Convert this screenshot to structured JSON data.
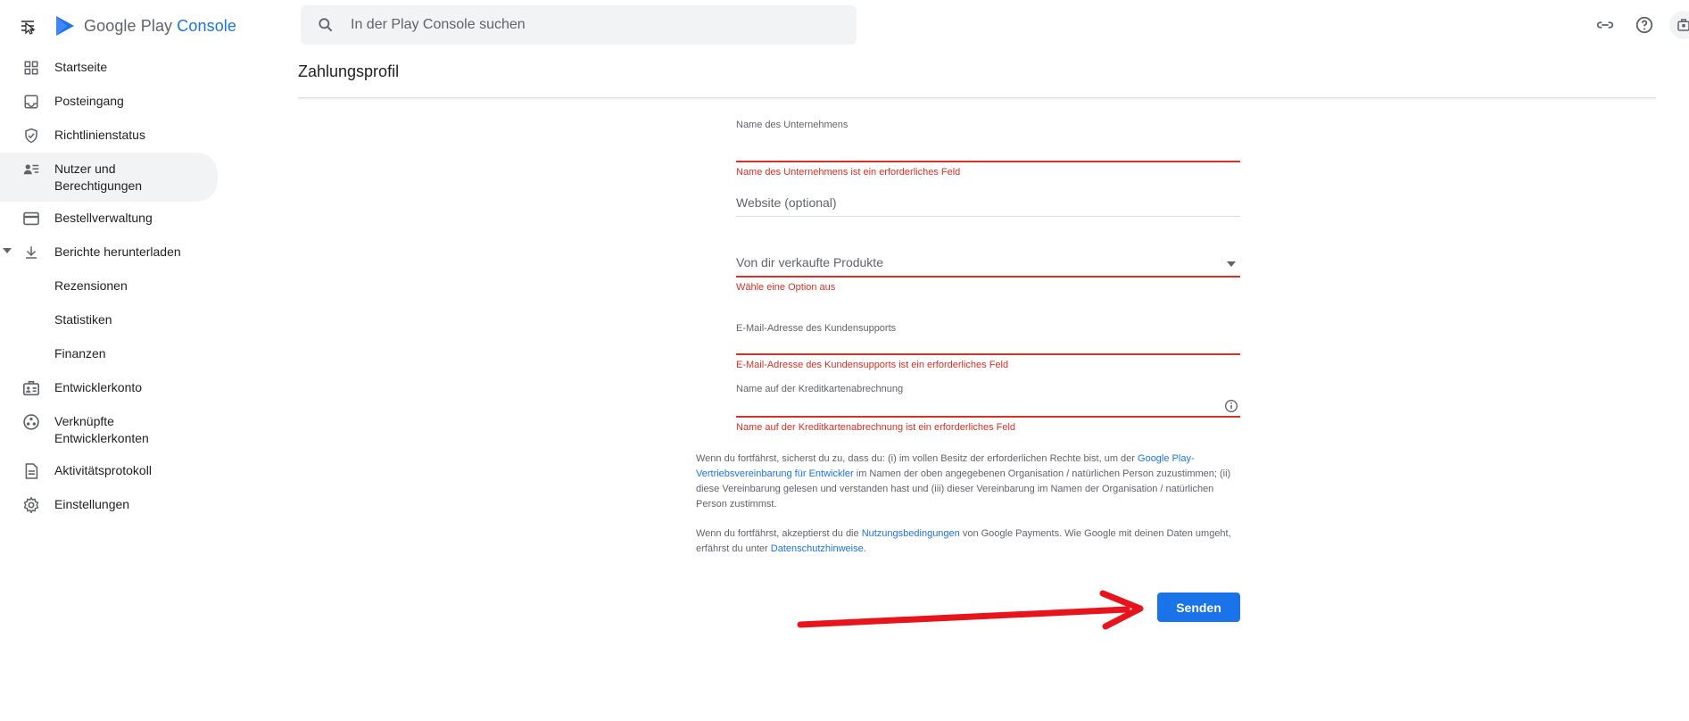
{
  "header": {
    "brand_name": "Google Play",
    "brand_suffix": "Console",
    "search_placeholder": "In der Play Console suchen"
  },
  "sidebar": {
    "items": [
      {
        "label": "Startseite",
        "icon": "dashboard-icon"
      },
      {
        "label": "Posteingang",
        "icon": "inbox-icon"
      },
      {
        "label": "Richtlinienstatus",
        "icon": "shield-icon"
      },
      {
        "label": "Nutzer und Berechtigungen",
        "icon": "users-icon"
      },
      {
        "label": "Bestellverwaltung",
        "icon": "credit-card-icon"
      },
      {
        "label": "Berichte herunterladen",
        "icon": "download-icon"
      },
      {
        "label": "Rezensionen"
      },
      {
        "label": "Statistiken"
      },
      {
        "label": "Finanzen"
      },
      {
        "label": "Entwicklerkonto",
        "icon": "badge-icon"
      },
      {
        "label": "Verknüpfte Entwicklerkonten",
        "icon": "linked-accounts-icon"
      },
      {
        "label": "Aktivitätsprotokoll",
        "icon": "document-icon"
      },
      {
        "label": "Einstellungen",
        "icon": "gear-icon"
      }
    ]
  },
  "page": {
    "title": "Zahlungsprofil"
  },
  "form": {
    "company_name_label": "Name des Unternehmens",
    "company_name_error": "Name des Unternehmens ist ein erforderliches Feld",
    "website_label": "Website (optional)",
    "products_label": "Von dir verkaufte Produkte",
    "products_error": "Wähle eine Option aus",
    "support_email_label": "E-Mail-Adresse des Kundensupports",
    "support_email_error": "E-Mail-Adresse des Kundensupports ist ein erforderliches Feld",
    "card_name_label": "Name auf der Kreditkartenabrechnung",
    "card_name_error": "Name auf der Kreditkartenabrechnung ist ein erforderliches Feld"
  },
  "consent": {
    "p1_a": "Wenn du fortfährst, sicherst du zu, dass du: (i) im vollen Besitz der erforderlichen Rechte bist, um der ",
    "p1_link": "Google Play-Vertriebsvereinbarung für Entwickler",
    "p1_b": " im Namen der oben angegebenen Organisation / natürlichen Person zuzustimmen; (ii) diese Vereinbarung gelesen und verstanden hast und (iii) dieser Vereinbarung im Namen der Organisation / natürlichen Person zustimmst.",
    "p2_a": "Wenn du fortfährst, akzeptierst du die ",
    "p2_link1": "Nutzungsbedingungen",
    "p2_b": " von Google Payments. Wie Google mit deinen Daten umgeht, erfährst du unter ",
    "p2_link2": "Datenschutzhinweise",
    "p2_c": "."
  },
  "actions": {
    "submit_label": "Senden"
  },
  "colors": {
    "accent": "#1a73e8",
    "error": "#d93025",
    "annotation_arrow": "#e8131b"
  }
}
